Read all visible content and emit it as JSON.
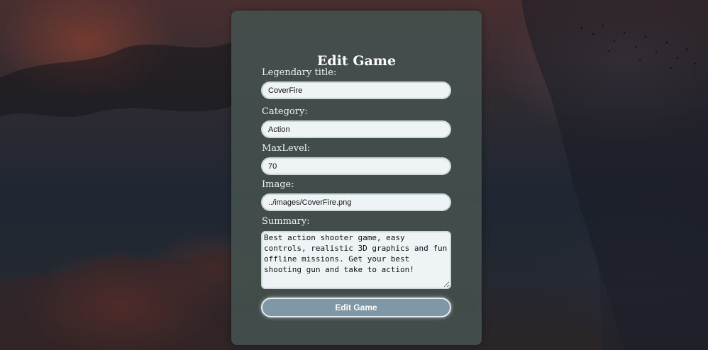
{
  "form": {
    "title": "Edit Game",
    "title_field": {
      "label": "Legendary title:",
      "value": "CoverFire"
    },
    "category_field": {
      "label": "Category:",
      "value": "Action"
    },
    "max_level_field": {
      "label": "MaxLevel:",
      "value": "70"
    },
    "image_field": {
      "label": "Image:",
      "value": "../images/CoverFire.png"
    },
    "summary_field": {
      "label": "Summary:",
      "value": "Best action shooter game, easy controls, realistic 3D graphics and fun offline missions. Get your best shooting gun and take to action!"
    },
    "submit_label": "Edit Game"
  },
  "colors": {
    "card_background": "#46524e",
    "button_background": "#7f97a6",
    "input_background": "#eef4f6"
  }
}
